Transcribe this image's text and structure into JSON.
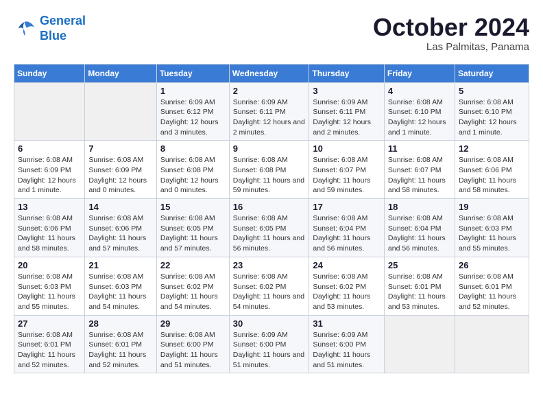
{
  "logo": {
    "line1": "General",
    "line2": "Blue"
  },
  "title": "October 2024",
  "subtitle": "Las Palmitas, Panama",
  "headers": [
    "Sunday",
    "Monday",
    "Tuesday",
    "Wednesday",
    "Thursday",
    "Friday",
    "Saturday"
  ],
  "rows": [
    [
      {
        "empty": true
      },
      {
        "empty": true
      },
      {
        "day": "1",
        "sunrise": "6:09 AM",
        "sunset": "6:12 PM",
        "daylight": "12 hours and 3 minutes."
      },
      {
        "day": "2",
        "sunrise": "6:09 AM",
        "sunset": "6:11 PM",
        "daylight": "12 hours and 2 minutes."
      },
      {
        "day": "3",
        "sunrise": "6:09 AM",
        "sunset": "6:11 PM",
        "daylight": "12 hours and 2 minutes."
      },
      {
        "day": "4",
        "sunrise": "6:08 AM",
        "sunset": "6:10 PM",
        "daylight": "12 hours and 1 minute."
      },
      {
        "day": "5",
        "sunrise": "6:08 AM",
        "sunset": "6:10 PM",
        "daylight": "12 hours and 1 minute."
      }
    ],
    [
      {
        "day": "6",
        "sunrise": "6:08 AM",
        "sunset": "6:09 PM",
        "daylight": "12 hours and 1 minute."
      },
      {
        "day": "7",
        "sunrise": "6:08 AM",
        "sunset": "6:09 PM",
        "daylight": "12 hours and 0 minutes."
      },
      {
        "day": "8",
        "sunrise": "6:08 AM",
        "sunset": "6:08 PM",
        "daylight": "12 hours and 0 minutes."
      },
      {
        "day": "9",
        "sunrise": "6:08 AM",
        "sunset": "6:08 PM",
        "daylight": "11 hours and 59 minutes."
      },
      {
        "day": "10",
        "sunrise": "6:08 AM",
        "sunset": "6:07 PM",
        "daylight": "11 hours and 59 minutes."
      },
      {
        "day": "11",
        "sunrise": "6:08 AM",
        "sunset": "6:07 PM",
        "daylight": "11 hours and 58 minutes."
      },
      {
        "day": "12",
        "sunrise": "6:08 AM",
        "sunset": "6:06 PM",
        "daylight": "11 hours and 58 minutes."
      }
    ],
    [
      {
        "day": "13",
        "sunrise": "6:08 AM",
        "sunset": "6:06 PM",
        "daylight": "11 hours and 58 minutes."
      },
      {
        "day": "14",
        "sunrise": "6:08 AM",
        "sunset": "6:06 PM",
        "daylight": "11 hours and 57 minutes."
      },
      {
        "day": "15",
        "sunrise": "6:08 AM",
        "sunset": "6:05 PM",
        "daylight": "11 hours and 57 minutes."
      },
      {
        "day": "16",
        "sunrise": "6:08 AM",
        "sunset": "6:05 PM",
        "daylight": "11 hours and 56 minutes."
      },
      {
        "day": "17",
        "sunrise": "6:08 AM",
        "sunset": "6:04 PM",
        "daylight": "11 hours and 56 minutes."
      },
      {
        "day": "18",
        "sunrise": "6:08 AM",
        "sunset": "6:04 PM",
        "daylight": "11 hours and 56 minutes."
      },
      {
        "day": "19",
        "sunrise": "6:08 AM",
        "sunset": "6:03 PM",
        "daylight": "11 hours and 55 minutes."
      }
    ],
    [
      {
        "day": "20",
        "sunrise": "6:08 AM",
        "sunset": "6:03 PM",
        "daylight": "11 hours and 55 minutes."
      },
      {
        "day": "21",
        "sunrise": "6:08 AM",
        "sunset": "6:03 PM",
        "daylight": "11 hours and 54 minutes."
      },
      {
        "day": "22",
        "sunrise": "6:08 AM",
        "sunset": "6:02 PM",
        "daylight": "11 hours and 54 minutes."
      },
      {
        "day": "23",
        "sunrise": "6:08 AM",
        "sunset": "6:02 PM",
        "daylight": "11 hours and 54 minutes."
      },
      {
        "day": "24",
        "sunrise": "6:08 AM",
        "sunset": "6:02 PM",
        "daylight": "11 hours and 53 minutes."
      },
      {
        "day": "25",
        "sunrise": "6:08 AM",
        "sunset": "6:01 PM",
        "daylight": "11 hours and 53 minutes."
      },
      {
        "day": "26",
        "sunrise": "6:08 AM",
        "sunset": "6:01 PM",
        "daylight": "11 hours and 52 minutes."
      }
    ],
    [
      {
        "day": "27",
        "sunrise": "6:08 AM",
        "sunset": "6:01 PM",
        "daylight": "11 hours and 52 minutes."
      },
      {
        "day": "28",
        "sunrise": "6:08 AM",
        "sunset": "6:01 PM",
        "daylight": "11 hours and 52 minutes."
      },
      {
        "day": "29",
        "sunrise": "6:08 AM",
        "sunset": "6:00 PM",
        "daylight": "11 hours and 51 minutes."
      },
      {
        "day": "30",
        "sunrise": "6:09 AM",
        "sunset": "6:00 PM",
        "daylight": "11 hours and 51 minutes."
      },
      {
        "day": "31",
        "sunrise": "6:09 AM",
        "sunset": "6:00 PM",
        "daylight": "11 hours and 51 minutes."
      },
      {
        "empty": true
      },
      {
        "empty": true
      }
    ]
  ]
}
